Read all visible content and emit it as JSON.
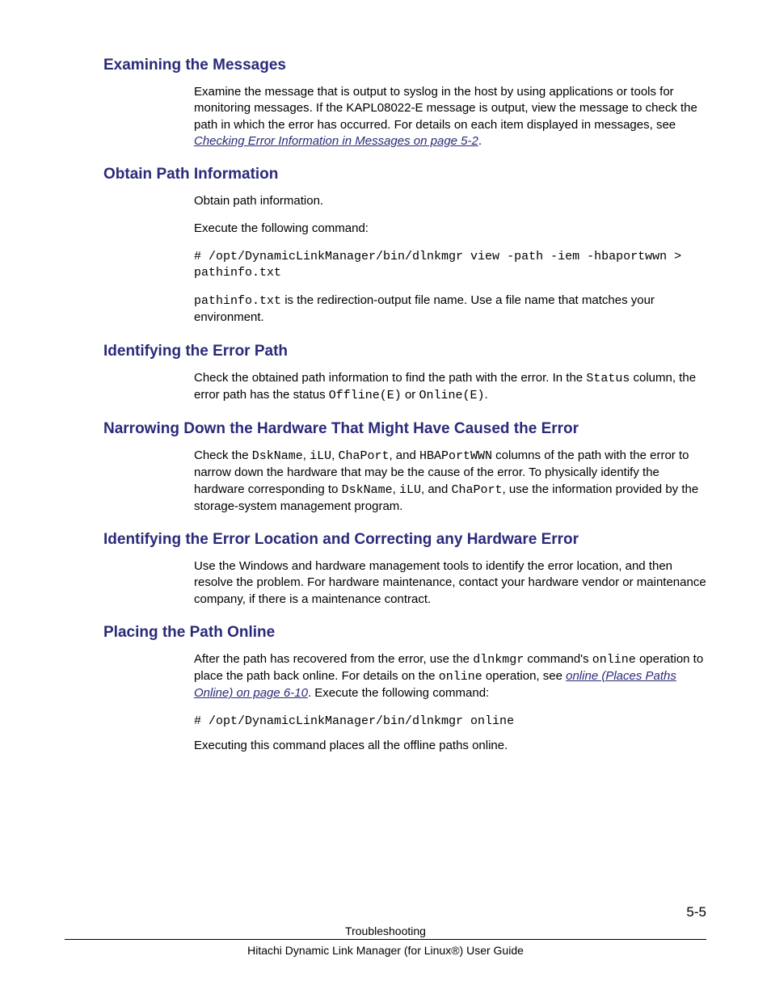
{
  "sections": {
    "s1": {
      "heading": "Examining the Messages",
      "p1a": "Examine the message that is output to syslog in the host by using applications or tools for monitoring messages. If the KAPL08022-E message is output, view the message to check the path in which the error has occurred. For details on each item displayed in messages, see ",
      "link1": "Checking Error Information in Messages on page 5-2",
      "p1b": "."
    },
    "s2": {
      "heading": "Obtain Path Information",
      "p1": "Obtain path information.",
      "p2": "Execute the following command:",
      "code1": "# /opt/DynamicLinkManager/bin/dlnkmgr view -path -iem -hbaportwwn > pathinfo.txt",
      "p3a": "pathinfo.txt",
      "p3b": " is the redirection-output file name. Use a file name that matches your environment."
    },
    "s3": {
      "heading": "Identifying the Error Path",
      "p1a": "Check the obtained path information to find the path with the error. In the ",
      "c1": "Status",
      "p1b": " column, the error path has the status ",
      "c2": "Offline(E)",
      "p1c": " or ",
      "c3": "Online(E)",
      "p1d": "."
    },
    "s4": {
      "heading": "Narrowing Down the Hardware That Might Have Caused the Error",
      "p1a": "Check the ",
      "c1": "DskName",
      "p1b": ", ",
      "c2": "iLU",
      "p1c": ", ",
      "c3": "ChaPort",
      "p1d": ", and ",
      "c4": "HBAPortWWN",
      "p1e": " columns of the path with the error to narrow down the hardware that may be the cause of the error. To physically identify the hardware corresponding to ",
      "c5": "DskName",
      "p1f": ", ",
      "c6": "iLU",
      "p1g": ", and ",
      "c7": "ChaPort",
      "p1h": ", use the information provided by the storage-system management program."
    },
    "s5": {
      "heading": "Identifying the Error Location and Correcting any Hardware Error",
      "p1": "Use the Windows and hardware management tools to identify the error location, and then resolve the problem. For hardware maintenance, contact your hardware vendor or maintenance company, if there is a maintenance contract."
    },
    "s6": {
      "heading": "Placing the Path Online",
      "p1a": "After the path has recovered from the error, use the ",
      "c1": "dlnkmgr",
      "p1b": " command's ",
      "c2": "online",
      "p1c": " operation to place the path back online. For details on the ",
      "c3": "online",
      "p1d": " operation, see ",
      "link1": "online (Places Paths Online) on page 6-10",
      "p1e": ". Execute the following command:",
      "code1": "# /opt/DynamicLinkManager/bin/dlnkmgr online",
      "p2": "Executing this command places all the offline paths online."
    }
  },
  "footer": {
    "line1": "Troubleshooting",
    "line2": "Hitachi Dynamic Link Manager (for Linux®) User Guide",
    "pagenum": "5-5"
  }
}
